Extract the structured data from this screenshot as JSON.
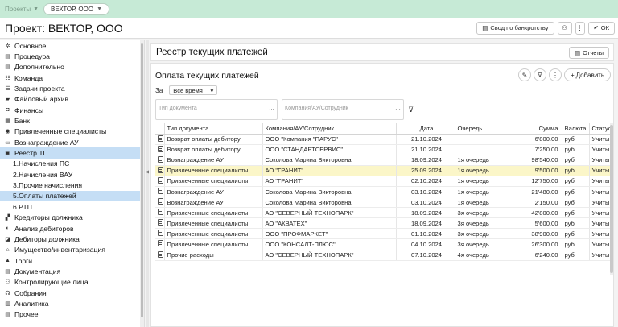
{
  "topbar": {
    "breadcrumb": "Проекты",
    "org": "ВЕКТОР, ООО"
  },
  "project": {
    "title": "Проект: ВЕКТОР, ООО",
    "bankruptcy_button": "Свод по банкротству",
    "ok_button": "ОК"
  },
  "sidebar": {
    "items": [
      {
        "label": "Основное",
        "icon": "gear-icon",
        "glyph": "✲"
      },
      {
        "label": "Процедура",
        "icon": "document-icon",
        "glyph": "▤"
      },
      {
        "label": "Дополнительно",
        "icon": "document-icon",
        "glyph": "▤"
      },
      {
        "label": "Команда",
        "icon": "team-icon",
        "glyph": "☷"
      },
      {
        "label": "Задачи проекта",
        "icon": "tasks-icon",
        "glyph": "☰"
      },
      {
        "label": "Файловый архив",
        "icon": "folder-icon",
        "glyph": "▰"
      },
      {
        "label": "Финансы",
        "icon": "finance-icon",
        "glyph": "◘"
      },
      {
        "label": "Банк",
        "icon": "bank-icon",
        "glyph": "▦"
      },
      {
        "label": "Привлеченные специалисты",
        "icon": "eye-icon",
        "glyph": "◉"
      },
      {
        "label": "Вознаграждение АУ",
        "icon": "wallet-icon",
        "glyph": "▭"
      },
      {
        "label": "Реестр ТП",
        "icon": "register-icon",
        "glyph": "▣",
        "active": true
      },
      {
        "label": "1.Начисления ПС",
        "sub": true
      },
      {
        "label": "2.Начисления ВАУ",
        "sub": true
      },
      {
        "label": "3.Прочие начисления",
        "sub": true
      },
      {
        "label": "5.Оплаты платежей",
        "sub": true,
        "active": true
      },
      {
        "label": "6.РТП",
        "sub": true
      },
      {
        "label": "Кредиторы должника",
        "icon": "creditors-icon",
        "glyph": "▞"
      },
      {
        "label": "Анализ дебиторов",
        "icon": "analysis-icon",
        "glyph": "◐"
      },
      {
        "label": "Дебиторы должника",
        "icon": "debtors-icon",
        "glyph": "◪"
      },
      {
        "label": "Имущество/инвентаризация",
        "icon": "property-icon",
        "glyph": "⌂"
      },
      {
        "label": "Торги",
        "icon": "auction-icon",
        "glyph": "▲"
      },
      {
        "label": "Документация",
        "icon": "document-icon",
        "glyph": "▤"
      },
      {
        "label": "Контролирующие лица",
        "icon": "persons-icon",
        "glyph": "⚇"
      },
      {
        "label": "Собрания",
        "icon": "meeting-icon",
        "glyph": "☊"
      },
      {
        "label": "Аналитика",
        "icon": "chart-icon",
        "glyph": "▥"
      },
      {
        "label": "Прочее",
        "icon": "document-icon",
        "glyph": "▤"
      }
    ]
  },
  "register": {
    "title": "Реестр текущих платежей",
    "reports_button": "Отчеты"
  },
  "payments": {
    "title": "Оплата текущих платежей",
    "add_button": "Добавить",
    "period_label": "За",
    "period_value": "Все время",
    "filter_doc_placeholder": "Тип документа",
    "filter_company_placeholder": "Компания/АУ/Сотрудник",
    "columns": [
      "Тип документа",
      "Компания/АУ/Сотрудник",
      "Дата",
      "Очередь",
      "Сумма",
      "Валюта",
      "Статус"
    ],
    "rows": [
      {
        "type": "Возврат оплаты дебитору",
        "company": "ООО \"Компания \"ПАРУС\"",
        "date": "21.10.2024",
        "queue": "",
        "sum": "6'800.00",
        "cur": "руб",
        "status": "Учитывать"
      },
      {
        "type": "Возврат оплаты дебитору",
        "company": "ООО \"СТАНДАРТСЕРВИС\"",
        "date": "21.10.2024",
        "queue": "",
        "sum": "7'250.00",
        "cur": "руб",
        "status": "Учитывать"
      },
      {
        "type": "Вознаграждение АУ",
        "company": "Соколова Марина Викторовна",
        "date": "18.09.2024",
        "queue": "1я очередь",
        "sum": "98'540.00",
        "cur": "руб",
        "status": "Учитывать"
      },
      {
        "type": "Привлеченные специалисты",
        "company": "АО \"ГРАНИТ\"",
        "date": "25.09.2024",
        "queue": "1я очередь",
        "sum": "9'500.00",
        "cur": "руб",
        "status": "Учитывать",
        "selected": true
      },
      {
        "type": "Привлеченные специалисты",
        "company": "АО \"ГРАНИТ\"",
        "date": "02.10.2024",
        "queue": "1я очередь",
        "sum": "12'750.00",
        "cur": "руб",
        "status": "Учитывать"
      },
      {
        "type": "Вознаграждение АУ",
        "company": "Соколова Марина Викторовна",
        "date": "03.10.2024",
        "queue": "1я очередь",
        "sum": "21'480.00",
        "cur": "руб",
        "status": "Учитывать"
      },
      {
        "type": "Вознаграждение АУ",
        "company": "Соколова Марина Викторовна",
        "date": "03.10.2024",
        "queue": "1я очередь",
        "sum": "2'150.00",
        "cur": "руб",
        "status": "Учитывать"
      },
      {
        "type": "Привлеченные специалисты",
        "company": "АО \"СЕВЕРНЫЙ ТЕХНОПАРК\"",
        "date": "18.09.2024",
        "queue": "3я очередь",
        "sum": "42'800.00",
        "cur": "руб",
        "status": "Учитывать"
      },
      {
        "type": "Привлеченные специалисты",
        "company": "АО \"АКВАТЕХ\"",
        "date": "18.09.2024",
        "queue": "3я очередь",
        "sum": "5'600.00",
        "cur": "руб",
        "status": "Учитывать"
      },
      {
        "type": "Привлеченные специалисты",
        "company": "ООО \"ПРОФМАРКЕТ\"",
        "date": "01.10.2024",
        "queue": "3я очередь",
        "sum": "38'900.00",
        "cur": "руб",
        "status": "Учитывать"
      },
      {
        "type": "Привлеченные специалисты",
        "company": "ООО \"КОНСАЛТ-ПЛЮС\"",
        "date": "04.10.2024",
        "queue": "3я очередь",
        "sum": "26'300.00",
        "cur": "руб",
        "status": "Учитывать"
      },
      {
        "type": "Прочие расходы",
        "company": "АО \"СЕВЕРНЫЙ ТЕХНОПАРК\"",
        "date": "07.10.2024",
        "queue": "4я очередь",
        "sum": "6'240.00",
        "cur": "руб",
        "status": "Учитывать"
      }
    ]
  }
}
